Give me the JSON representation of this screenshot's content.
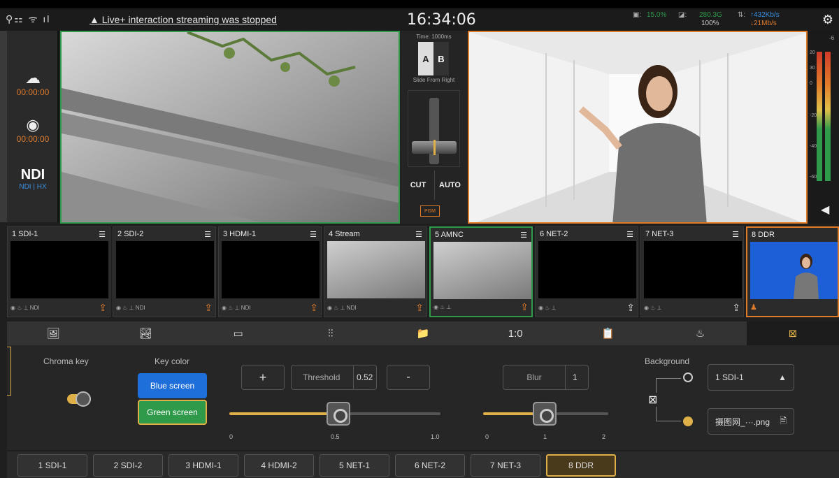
{
  "topbar": {
    "signal_glyphs": "⚲⚏ ᯤ ıl",
    "notice": "Live+ interaction streaming was stopped",
    "clock": "16:34:06",
    "cpu": "15.0%",
    "disk_total": "280.3G",
    "disk_pct": "100%",
    "up_rate": "↑432Kb/s",
    "down_rate": "↓21Mb/s"
  },
  "left_panel": {
    "stream_time": "00:00:00",
    "record_time": "00:00:00",
    "ndi_logo": "NDI",
    "ndi_sub": "NDI | HX"
  },
  "transition": {
    "time_label": "Time: 1000ms",
    "a_label": "A",
    "b_label": "B",
    "effect": "Slide From Right",
    "cut": "CUT",
    "auto": "AUTO",
    "pgm": "PGM"
  },
  "vu": {
    "ticks": [
      "-6",
      "20",
      "30",
      "0",
      "-20",
      "-40",
      "-60"
    ]
  },
  "sources": [
    {
      "label": "1 SDI-1",
      "flags": "◉ ♨ ⊥ NDI"
    },
    {
      "label": "2 SDI-2",
      "flags": "◉ ♨ ⊥ NDI"
    },
    {
      "label": "3 HDMI-1",
      "flags": "◉ ♨ ⊥ NDI"
    },
    {
      "label": "4 Stream",
      "flags": "◉ ♨ ⊥ NDI"
    },
    {
      "label": "5 AMNC",
      "flags": "◉ ♨ ⊥"
    },
    {
      "label": "6 NET-2",
      "flags": "◉ ♨ ⊥"
    },
    {
      "label": "7 NET-3",
      "flags": "◉ ♨ ⊥"
    },
    {
      "label": "8 DDR",
      "flags": ""
    }
  ],
  "tabs": [
    "🖼",
    "🏞",
    "▭",
    "⫶⫶",
    "📁",
    "1:0",
    "📋",
    "♨",
    "⊠"
  ],
  "chroma": {
    "title": "Chroma key",
    "key_color_label": "Key color",
    "blue": "Blue screen",
    "green": "Green screen",
    "plus": "+",
    "minus": "-",
    "threshold_label": "Threshold",
    "threshold_value": "0.52",
    "threshold_ticks": [
      "0",
      "0.5",
      "1.0"
    ],
    "blur_label": "Blur",
    "blur_value": "1",
    "blur_ticks": [
      "0",
      "1",
      "2"
    ],
    "background_label": "Background",
    "bg_source": "1 SDI-1",
    "bg_file": "摄图网_···.png"
  },
  "bottom_buttons": [
    "1 SDI-1",
    "2 SDI-2",
    "3 HDMI-1",
    "4 HDMI-2",
    "5 NET-1",
    "6 NET-2",
    "7 NET-3",
    "8 DDR"
  ],
  "colors": {
    "accent_orange": "#e07b2a",
    "accent_green": "#2e9a4a",
    "accent_gold": "#e0b048",
    "blue_btn": "#1e6fd9"
  }
}
